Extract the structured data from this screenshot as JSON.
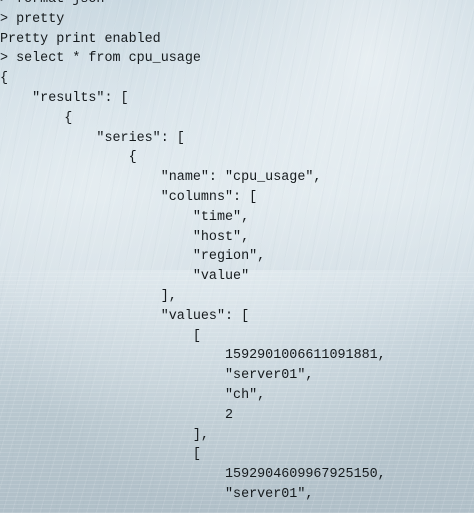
{
  "terminal": {
    "lines": [
      "> format json",
      "> pretty",
      "Pretty print enabled",
      "> select * from cpu_usage",
      "{",
      "    \"results\": [",
      "        {",
      "            \"series\": [",
      "                {",
      "                    \"name\": \"cpu_usage\",",
      "                    \"columns\": [",
      "                        \"time\",",
      "                        \"host\",",
      "                        \"region\",",
      "                        \"value\"",
      "                    ],",
      "                    \"values\": [",
      "                        [",
      "                            1592901006611091881,",
      "                            \"server01\",",
      "                            \"ch\",",
      "                            2",
      "                        ],",
      "                        [",
      "                            1592904609967925150,",
      "                            \"server01\","
    ]
  },
  "background": {
    "scene": "rainy-water-wallpaper",
    "sky_color": "#d7e3e9",
    "water_color": "#b7c6ce"
  }
}
